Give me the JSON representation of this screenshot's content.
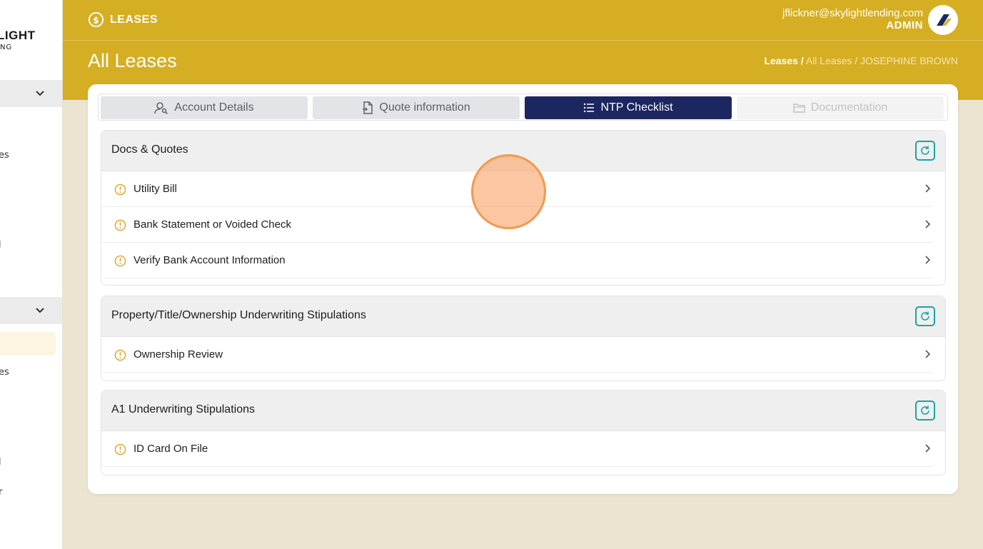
{
  "sidebar": {
    "logo_main": "LIGHT",
    "logo_sub": "ING",
    "fragments": [
      "es",
      "l",
      "es",
      "l",
      "r"
    ]
  },
  "header": {
    "section_label": "LEASES",
    "user_email": "jflickner@skylightlending.com",
    "user_role": "ADMIN",
    "page_title": "All Leases",
    "breadcrumb": {
      "first": "Leases /",
      "rest": "All Leases / JOSEPHINE BROWN"
    }
  },
  "tabs": [
    {
      "label": "Account Details",
      "icon": "user-search-icon",
      "state": "default"
    },
    {
      "label": "Quote information",
      "icon": "document-icon",
      "state": "default"
    },
    {
      "label": "NTP Checklist",
      "icon": "list-icon",
      "state": "active"
    },
    {
      "label": "Documentation",
      "icon": "folder-icon",
      "state": "disabled"
    }
  ],
  "panels": [
    {
      "title": "Docs & Quotes",
      "items": [
        "Utility Bill",
        "Bank Statement or Voided Check",
        "Verify Bank Account Information"
      ]
    },
    {
      "title": "Property/Title/Ownership Underwriting Stipulations",
      "items": [
        "Ownership Review"
      ]
    },
    {
      "title": "A1 Underwriting Stipulations",
      "items": [
        "ID Card On File"
      ]
    }
  ],
  "colors": {
    "header_bg": "#d6ae23",
    "active_tab": "#1c2660",
    "refresh_accent": "#1aa3a6",
    "warning": "#e6a123"
  }
}
